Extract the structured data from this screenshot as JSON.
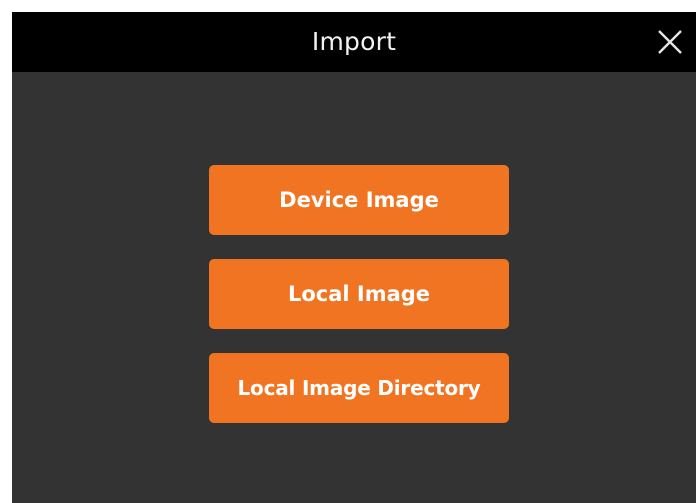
{
  "dialog": {
    "title": "Import",
    "close_icon": "close-icon"
  },
  "buttons": {
    "device_image": "Device Image",
    "local_image": "Local Image",
    "local_image_directory": "Local Image Directory"
  },
  "colors": {
    "titlebar": "#000000",
    "panel": "#333333",
    "accent": "#f07422",
    "button_text": "#ffffff",
    "title_text": "#f2f2f2"
  }
}
